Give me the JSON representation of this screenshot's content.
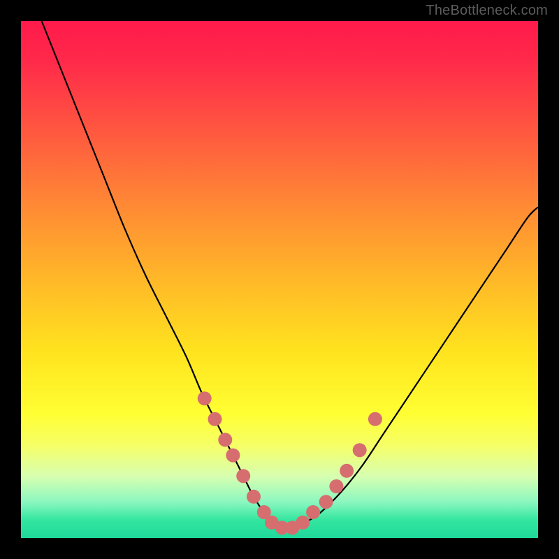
{
  "watermark": "TheBottleneck.com",
  "colors": {
    "curve": "#000000",
    "marker_fill": "#d66e6f",
    "marker_stroke": "#b85c5d"
  },
  "chart_data": {
    "type": "line",
    "title": "",
    "xlabel": "",
    "ylabel": "",
    "xlim": [
      0,
      100
    ],
    "ylim": [
      0,
      100
    ],
    "grid": false,
    "series": [
      {
        "name": "bottleneck-curve",
        "x": [
          4,
          8,
          12,
          16,
          20,
          24,
          28,
          32,
          35,
          38,
          41,
          43,
          45,
          47,
          49,
          51,
          53,
          55,
          58,
          62,
          66,
          70,
          74,
          78,
          82,
          86,
          90,
          94,
          98,
          100
        ],
        "y": [
          100,
          90,
          80,
          70,
          60,
          51,
          43,
          35,
          28,
          22,
          16,
          12,
          8,
          5,
          3,
          2,
          2,
          3,
          5,
          9,
          14,
          20,
          26,
          32,
          38,
          44,
          50,
          56,
          62,
          64
        ]
      }
    ],
    "markers": {
      "name": "highlight-points",
      "x": [
        35.5,
        37.5,
        39.5,
        41,
        43,
        45,
        47,
        48.5,
        50.5,
        52.5,
        54.5,
        56.5,
        59,
        61,
        63,
        65.5,
        68.5
      ],
      "y": [
        27,
        23,
        19,
        16,
        12,
        8,
        5,
        3,
        2,
        2,
        3,
        5,
        7,
        10,
        13,
        17,
        23
      ]
    }
  }
}
